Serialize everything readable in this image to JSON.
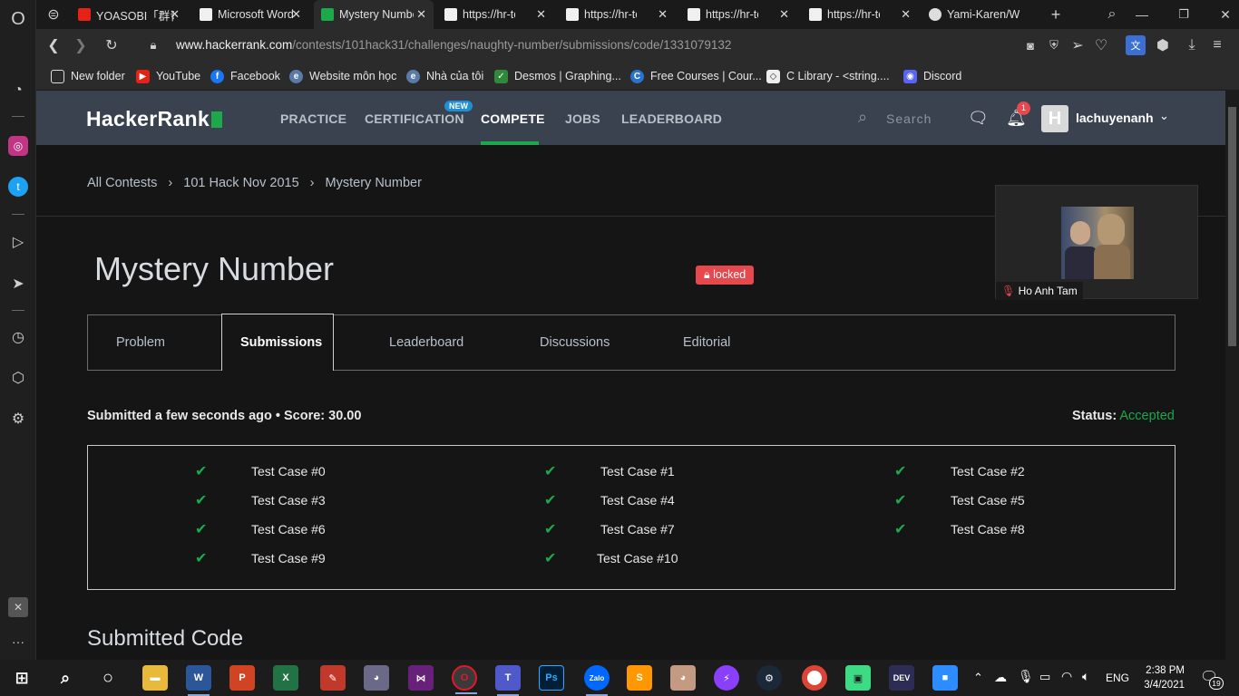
{
  "browser": {
    "tabs": [
      {
        "title": "YOASOBI「群青」",
        "active": false
      },
      {
        "title": "Microsoft Word",
        "active": false
      },
      {
        "title": "Mystery Number",
        "active": true
      },
      {
        "title": "https://hr-testc",
        "active": false
      },
      {
        "title": "https://hr-testc",
        "active": false
      },
      {
        "title": "https://hr-testc",
        "active": false
      },
      {
        "title": "https://hr-testc",
        "active": false
      },
      {
        "title": "Yami-Karen/W",
        "active": false
      }
    ],
    "url_domain": "www.hackerrank.com",
    "url_path": "/contests/101hack31/challenges/naughty-number/submissions/code/1331079132",
    "bookmarks": [
      {
        "label": "New folder",
        "icon": "folder-icon"
      },
      {
        "label": "YouTube",
        "icon": "youtube-icon"
      },
      {
        "label": "Facebook",
        "icon": "facebook-icon"
      },
      {
        "label": "Website môn học",
        "icon": "globe-icon"
      },
      {
        "label": "Nhà của tôi",
        "icon": "globe-icon"
      },
      {
        "label": "Desmos | Graphing...",
        "icon": "desmos-icon"
      },
      {
        "label": "Free Courses | Cour...",
        "icon": "coursera-icon"
      },
      {
        "label": "C Library - <string....",
        "icon": "cplusplus-icon"
      },
      {
        "label": "Discord",
        "icon": "discord-icon"
      }
    ]
  },
  "hackerrank": {
    "logo": "HackerRank",
    "nav": [
      "PRACTICE",
      "CERTIFICATION",
      "COMPETE",
      "JOBS",
      "LEADERBOARD"
    ],
    "new_badge": "NEW",
    "search_placeholder": "Search",
    "notification_count": "1",
    "username": "lachuyenanh",
    "avatar_letter": "H"
  },
  "breadcrumb": [
    "All Contests",
    "101 Hack Nov 2015",
    "Mystery Number"
  ],
  "challenge": {
    "title": "Mystery Number",
    "locked_label": "locked",
    "tabs": [
      "Problem",
      "Submissions",
      "Leaderboard",
      "Discussions",
      "Editorial"
    ],
    "active_tab": "Submissions"
  },
  "submission": {
    "summary": "Submitted a few seconds ago • Score: 30.00",
    "status_label": "Status:",
    "status_value": "Accepted",
    "test_cases": [
      "Test Case #0",
      "Test Case #1",
      "Test Case #2",
      "Test Case #3",
      "Test Case #4",
      "Test Case #5",
      "Test Case #6",
      "Test Case #7",
      "Test Case #8",
      "Test Case #9",
      "Test Case #10"
    ],
    "code_heading": "Submitted Code"
  },
  "video_overlay": {
    "name": "Ho Anh Tam"
  },
  "taskbar": {
    "language": "ENG",
    "time": "2:38 PM",
    "date": "3/4/2021",
    "notification_count": "19"
  },
  "colors": {
    "accent_green": "#1ba94c",
    "nav_bg": "#39424e",
    "locked_red": "#e5484d"
  }
}
